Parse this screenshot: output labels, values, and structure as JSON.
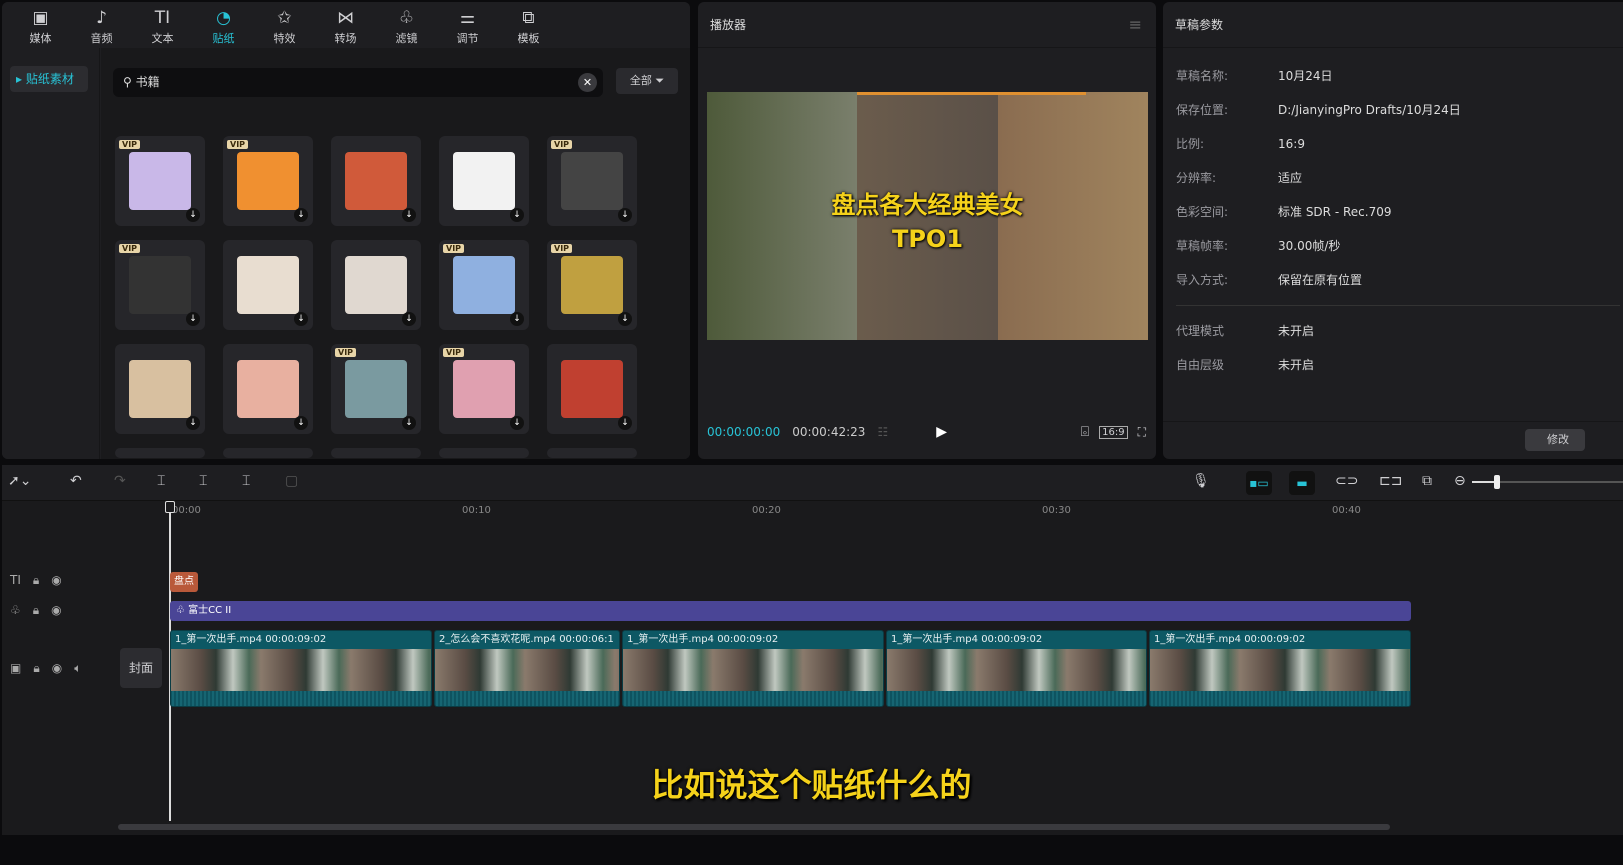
{
  "tabs": [
    {
      "label": "媒体",
      "icon": "media-icon",
      "glyph": "▣"
    },
    {
      "label": "音频",
      "icon": "audio-icon",
      "glyph": "♪"
    },
    {
      "label": "文本",
      "icon": "text-icon",
      "glyph": "TI"
    },
    {
      "label": "贴纸",
      "icon": "sticker-icon",
      "glyph": "◔"
    },
    {
      "label": "特效",
      "icon": "effects-icon",
      "glyph": "✩"
    },
    {
      "label": "转场",
      "icon": "transition-icon",
      "glyph": "⋈"
    },
    {
      "label": "滤镜",
      "icon": "filter-icon",
      "glyph": "♧"
    },
    {
      "label": "调节",
      "icon": "adjust-icon",
      "glyph": "⚌"
    },
    {
      "label": "模板",
      "icon": "template-icon",
      "glyph": "⧉"
    }
  ],
  "active_tab": "贴纸",
  "sidebar": {
    "item": "贴纸素材"
  },
  "search": {
    "value": "书籍",
    "filter": "全部"
  },
  "stickers": [
    {
      "vip": true,
      "color": "#c9b8e8"
    },
    {
      "vip": true,
      "color": "#f09030"
    },
    {
      "vip": false,
      "color": "#d05a3a"
    },
    {
      "vip": false,
      "color": "#f2f2f2"
    },
    {
      "vip": true,
      "color": "#444"
    },
    {
      "vip": true,
      "color": "#333"
    },
    {
      "vip": false,
      "color": "#e8ddd0"
    },
    {
      "vip": false,
      "color": "#e0d8d0"
    },
    {
      "vip": true,
      "color": "#8fb0e0"
    },
    {
      "vip": true,
      "color": "#c0a040"
    },
    {
      "vip": false,
      "color": "#d8c0a0"
    },
    {
      "vip": false,
      "color": "#e8b0a0"
    },
    {
      "vip": true,
      "color": "#7a9aa0"
    },
    {
      "vip": true,
      "color": "#e0a0b0"
    },
    {
      "vip": false,
      "color": "#c04030"
    }
  ],
  "accent": "#28c3d6",
  "player": {
    "title": "播放器",
    "video_text_line1": "盘点各大经典美女",
    "video_text_line2": "TPO1",
    "current": "00:00:00:00",
    "total": "00:00:42:23",
    "ratio": "16:9"
  },
  "params": {
    "title": "草稿参数",
    "rows": [
      {
        "k": "草稿名称:",
        "v": "10月24日"
      },
      {
        "k": "保存位置:",
        "v": "D:/JianyingPro Drafts/10月24日"
      },
      {
        "k": "比例:",
        "v": "16:9"
      },
      {
        "k": "分辨率:",
        "v": "适应"
      },
      {
        "k": "色彩空间:",
        "v": "标准 SDR - Rec.709"
      },
      {
        "k": "草稿帧率:",
        "v": "30.00帧/秒"
      },
      {
        "k": "导入方式:",
        "v": "保留在原有位置"
      }
    ],
    "rows2": [
      {
        "k": "代理模式",
        "v": "未开启"
      },
      {
        "k": "自由层级",
        "v": "未开启"
      }
    ],
    "button": "修改"
  },
  "timeline": {
    "ticks": [
      "00:00",
      "00:10",
      "00:20",
      "00:30",
      "00:40"
    ],
    "text_clip": "盘点",
    "filter_clip": "富士CC II",
    "cover": "封面",
    "video_clips": [
      {
        "name": "1_第一次出手.mp4",
        "dur": "00:00:09:02"
      },
      {
        "name": "2_怎么会不喜欢花呢.mp4",
        "dur": "00:00:06:1"
      },
      {
        "name": "1_第一次出手.mp4",
        "dur": "00:00:09:02"
      },
      {
        "name": "1_第一次出手.mp4",
        "dur": "00:00:09:02"
      },
      {
        "name": "1_第一次出手.mp4",
        "dur": "00:00:09:02"
      }
    ]
  },
  "subtitle": "比如说这个贴纸什么的"
}
